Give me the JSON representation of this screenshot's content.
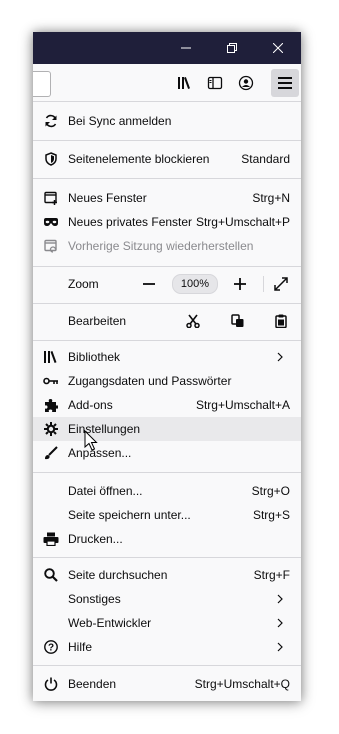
{
  "window_controls": {
    "minimize_icon": "minimize-icon",
    "restore_icon": "restore-icon",
    "close_icon": "close-icon"
  },
  "toolbar": {
    "icons": [
      "library-icon",
      "sidebar-icon",
      "account-icon",
      "hamburger-menu-icon"
    ]
  },
  "menu": {
    "sync": {
      "label": "Bei Sync anmelden",
      "icon": "sync-icon"
    },
    "content_blocking": {
      "label": "Seitenelemente blockieren",
      "shortcut": "Standard",
      "icon": "shield-icon"
    },
    "new_window": {
      "label": "Neues Fenster",
      "shortcut": "Strg+N",
      "icon": "new-window-icon"
    },
    "new_private_window": {
      "label": "Neues privates Fenster",
      "shortcut": "Strg+Umschalt+P",
      "icon": "private-mask-icon"
    },
    "restore_session": {
      "label": "Vorherige Sitzung wiederherstellen",
      "icon": "restore-session-icon"
    },
    "zoom": {
      "label": "Zoom",
      "value": "100%",
      "minus": "−",
      "plus": "+"
    },
    "edit": {
      "label": "Bearbeiten"
    },
    "library": {
      "label": "Bibliothek",
      "icon": "library-icon"
    },
    "logins": {
      "label": "Zugangsdaten und Passwörter",
      "icon": "key-icon"
    },
    "addons": {
      "label": "Add-ons",
      "shortcut": "Strg+Umschalt+A",
      "icon": "puzzle-icon"
    },
    "settings": {
      "label": "Einstellungen",
      "icon": "gear-icon"
    },
    "customize": {
      "label": "Anpassen...",
      "icon": "brush-icon"
    },
    "open_file": {
      "label": "Datei öffnen...",
      "shortcut": "Strg+O"
    },
    "save_page": {
      "label": "Seite speichern unter...",
      "shortcut": "Strg+S"
    },
    "print": {
      "label": "Drucken...",
      "icon": "printer-icon"
    },
    "find": {
      "label": "Seite durchsuchen",
      "shortcut": "Strg+F",
      "icon": "search-icon"
    },
    "more": {
      "label": "Sonstiges"
    },
    "web_developer": {
      "label": "Web-Entwickler"
    },
    "help": {
      "label": "Hilfe",
      "icon": "help-icon"
    },
    "quit": {
      "label": "Beenden",
      "shortcut": "Strg+Umschalt+Q",
      "icon": "power-icon"
    }
  },
  "colors": {
    "titlebar": "#1f1f3a",
    "menu_bg": "#f9f9fa",
    "hover_bg": "#e9e9eb",
    "disabled_text": "#8a8a8e"
  }
}
